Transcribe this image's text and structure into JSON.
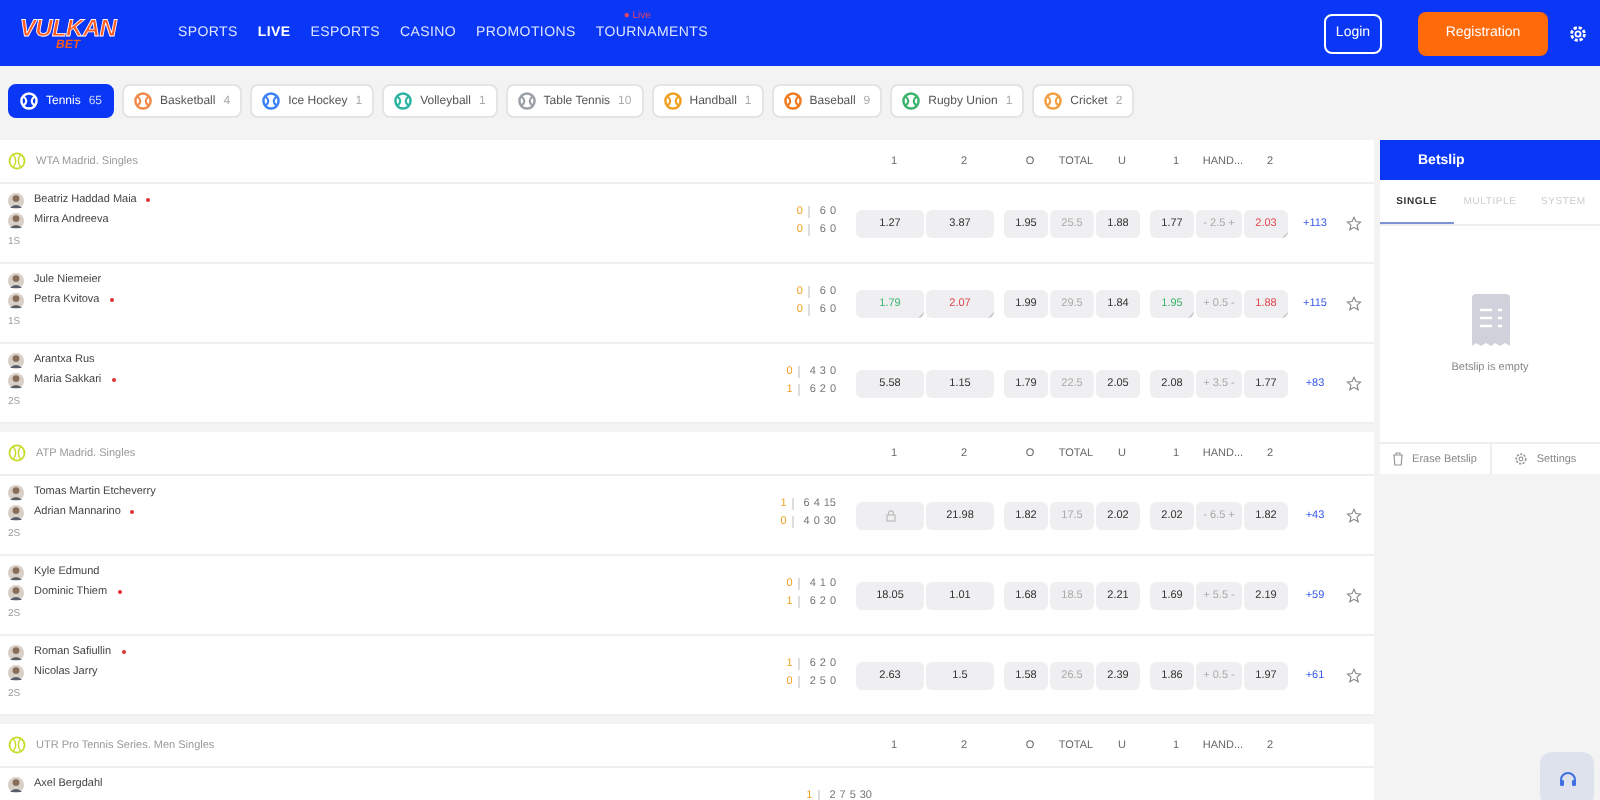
{
  "header": {
    "logo": {
      "top": "VULKAN",
      "bottom": "BET"
    },
    "nav": [
      {
        "label": "SPORTS",
        "selected": false
      },
      {
        "label": "LIVE",
        "selected": true
      },
      {
        "label": "ESPORTS",
        "selected": false
      },
      {
        "label": "CASINO",
        "selected": false
      },
      {
        "label": "PROMOTIONS",
        "selected": false
      },
      {
        "label": "TOURNAMENTS",
        "selected": false,
        "badge": "● Live"
      }
    ],
    "login": "Login",
    "register": "Registration"
  },
  "sports": [
    {
      "label": "Tennis",
      "count": "65",
      "selected": true,
      "color": "#ffffff"
    },
    {
      "label": "Basketball",
      "count": "4",
      "selected": false,
      "color": "#f08a4b"
    },
    {
      "label": "Ice Hockey",
      "count": "1",
      "selected": false,
      "color": "#3b82f6"
    },
    {
      "label": "Volleyball",
      "count": "1",
      "selected": false,
      "color": "#2bb3a3"
    },
    {
      "label": "Table Tennis",
      "count": "10",
      "selected": false,
      "color": "#9aa0a6"
    },
    {
      "label": "Handball",
      "count": "1",
      "selected": false,
      "color": "#f0a020"
    },
    {
      "label": "Baseball",
      "count": "9",
      "selected": false,
      "color": "#f07a1f"
    },
    {
      "label": "Rugby Union",
      "count": "1",
      "selected": false,
      "color": "#3bb36b"
    },
    {
      "label": "Cricket",
      "count": "2",
      "selected": false,
      "color": "#f0a040"
    }
  ],
  "sections": [
    {
      "tournament": "WTA Madrid. Singles",
      "columns": [
        "1",
        "2",
        "O",
        "TOTAL",
        "U",
        "1",
        "HAND...",
        "2"
      ],
      "matches": [
        {
          "period": "1S",
          "more": "+113",
          "players": [
            {
              "name": "Beatriz Haddad Maia",
              "serving": true,
              "point": "0",
              "games": [
                "6",
                "0"
              ]
            },
            {
              "name": "Mirra Andreeva",
              "serving": false,
              "point": "0",
              "games": [
                "6",
                "0"
              ]
            }
          ],
          "odds": [
            {
              "kind": "odd",
              "value": "1.27"
            },
            {
              "kind": "odd",
              "value": "3.87"
            },
            {
              "kind": "odd",
              "value": "1.95"
            },
            {
              "kind": "line",
              "value": "25.5"
            },
            {
              "kind": "odd",
              "value": "1.88"
            },
            {
              "kind": "odd",
              "value": "1.77"
            },
            {
              "kind": "line",
              "value": "- 2.5 +"
            },
            {
              "kind": "falling",
              "value": "2.03"
            }
          ]
        },
        {
          "period": "1S",
          "more": "+115",
          "players": [
            {
              "name": "Jule Niemeier",
              "serving": false,
              "point": "0",
              "games": [
                "6",
                "0"
              ]
            },
            {
              "name": "Petra Kvitova",
              "serving": true,
              "point": "0",
              "games": [
                "6",
                "0"
              ]
            }
          ],
          "odds": [
            {
              "kind": "rising",
              "value": "1.79"
            },
            {
              "kind": "falling",
              "value": "2.07"
            },
            {
              "kind": "odd",
              "value": "1.99"
            },
            {
              "kind": "line",
              "value": "29.5"
            },
            {
              "kind": "odd",
              "value": "1.84"
            },
            {
              "kind": "rising",
              "value": "1.95"
            },
            {
              "kind": "line",
              "value": "+ 0.5 -"
            },
            {
              "kind": "falling",
              "value": "1.88"
            }
          ]
        },
        {
          "period": "2S",
          "more": "+83",
          "players": [
            {
              "name": "Arantxa Rus",
              "serving": false,
              "point": "0",
              "games": [
                "4",
                "3",
                "0"
              ]
            },
            {
              "name": "Maria Sakkari",
              "serving": true,
              "point": "1",
              "games": [
                "6",
                "2",
                "0"
              ]
            }
          ],
          "odds": [
            {
              "kind": "odd",
              "value": "5.58"
            },
            {
              "kind": "odd",
              "value": "1.15"
            },
            {
              "kind": "odd",
              "value": "1.79"
            },
            {
              "kind": "line",
              "value": "22.5"
            },
            {
              "kind": "odd",
              "value": "2.05"
            },
            {
              "kind": "odd",
              "value": "2.08"
            },
            {
              "kind": "line",
              "value": "+ 3.5 -"
            },
            {
              "kind": "odd",
              "value": "1.77"
            }
          ]
        }
      ]
    },
    {
      "tournament": "ATP Madrid. Singles",
      "columns": [
        "1",
        "2",
        "O",
        "TOTAL",
        "U",
        "1",
        "HAND...",
        "2"
      ],
      "matches": [
        {
          "period": "2S",
          "more": "+43",
          "players": [
            {
              "name": "Tomas Martin Etcheverry",
              "serving": false,
              "point": "1",
              "games": [
                "6",
                "4",
                "15"
              ]
            },
            {
              "name": "Adrian Mannarino",
              "serving": true,
              "point": "0",
              "games": [
                "4",
                "0",
                "30"
              ]
            }
          ],
          "odds": [
            {
              "kind": "locked"
            },
            {
              "kind": "odd",
              "value": "21.98"
            },
            {
              "kind": "odd",
              "value": "1.82"
            },
            {
              "kind": "line",
              "value": "17.5"
            },
            {
              "kind": "odd",
              "value": "2.02"
            },
            {
              "kind": "odd",
              "value": "2.02"
            },
            {
              "kind": "line",
              "value": "- 6.5 +"
            },
            {
              "kind": "odd",
              "value": "1.82"
            }
          ]
        },
        {
          "period": "2S",
          "more": "+59",
          "players": [
            {
              "name": "Kyle Edmund",
              "serving": false,
              "point": "0",
              "games": [
                "4",
                "1",
                "0"
              ]
            },
            {
              "name": "Dominic Thiem",
              "serving": true,
              "point": "1",
              "games": [
                "6",
                "2",
                "0"
              ]
            }
          ],
          "odds": [
            {
              "kind": "odd",
              "value": "18.05"
            },
            {
              "kind": "odd",
              "value": "1.01"
            },
            {
              "kind": "odd",
              "value": "1.68"
            },
            {
              "kind": "line",
              "value": "18.5"
            },
            {
              "kind": "odd",
              "value": "2.21"
            },
            {
              "kind": "odd",
              "value": "1.69"
            },
            {
              "kind": "line",
              "value": "+ 5.5 -"
            },
            {
              "kind": "odd",
              "value": "2.19"
            }
          ]
        },
        {
          "period": "2S",
          "more": "+61",
          "players": [
            {
              "name": "Roman Safiullin",
              "serving": true,
              "point": "1",
              "games": [
                "6",
                "2",
                "0"
              ]
            },
            {
              "name": "Nicolas Jarry",
              "serving": false,
              "point": "0",
              "games": [
                "2",
                "5",
                "0"
              ]
            }
          ],
          "odds": [
            {
              "kind": "odd",
              "value": "2.63"
            },
            {
              "kind": "odd",
              "value": "1.5"
            },
            {
              "kind": "odd",
              "value": "1.58"
            },
            {
              "kind": "line",
              "value": "26.5"
            },
            {
              "kind": "odd",
              "value": "2.39"
            },
            {
              "kind": "odd",
              "value": "1.86"
            },
            {
              "kind": "line",
              "value": "+ 0.5 -"
            },
            {
              "kind": "odd",
              "value": "1.97"
            }
          ]
        }
      ]
    },
    {
      "tournament": "UTR Pro Tennis Series. Men Singles",
      "columns": [
        "1",
        "2",
        "O",
        "TOTAL",
        "U",
        "1",
        "HAND...",
        "2"
      ],
      "matches": [
        {
          "players": [
            {
              "name": "Axel Bergdahl",
              "serving": false,
              "point": "1",
              "games": [
                "2",
                "7",
                "5",
                "30"
              ]
            }
          ]
        }
      ]
    }
  ],
  "betslip": {
    "title": "Betslip",
    "tabs": [
      {
        "label": "SINGLE",
        "selected": true
      },
      {
        "label": "MULTIPLE",
        "selected": false
      },
      {
        "label": "SYSTEM",
        "selected": false
      }
    ],
    "empty": "Betslip is empty",
    "erase": "Erase Betslip",
    "settings": "Settings"
  }
}
